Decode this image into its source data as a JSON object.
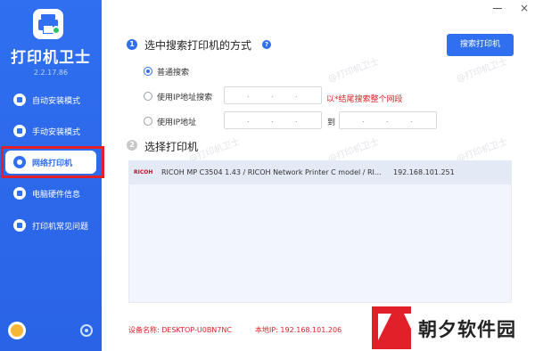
{
  "app": {
    "name": "打印机卫士",
    "version": "2.2.17.86"
  },
  "sidebar": {
    "items": [
      {
        "label": "自动安装模式"
      },
      {
        "label": "手动安装模式"
      },
      {
        "label": "网络打印机"
      },
      {
        "label": "电脑硬件信息"
      },
      {
        "label": "打印机常见问题"
      }
    ]
  },
  "step1": {
    "number": "1",
    "title": "选中搜索打印机的方式",
    "help": "?",
    "search_button": "搜索打印机",
    "options": [
      {
        "label": "普通搜索"
      },
      {
        "label": "使用IP地址搜索"
      },
      {
        "label": "使用IP地址"
      }
    ],
    "hint": "以*结尾搜索整个网段",
    "range_to": "到"
  },
  "step2": {
    "number": "2",
    "title": "选择打印机",
    "printers": [
      {
        "brand": "RICOH",
        "name": "RICOH MP C3504 1.43 / RICOH Network Printer C model / RI...",
        "ip": "192.168.101.251"
      }
    ]
  },
  "footer": {
    "device_label": "设备名称: DESKTOP-U0BN7NC",
    "ip_label": "本地IP: 192.168.101.206"
  },
  "watermark": "@打印机卫士",
  "brand": {
    "text": "朝夕软件园"
  },
  "window": {
    "close": "×"
  }
}
